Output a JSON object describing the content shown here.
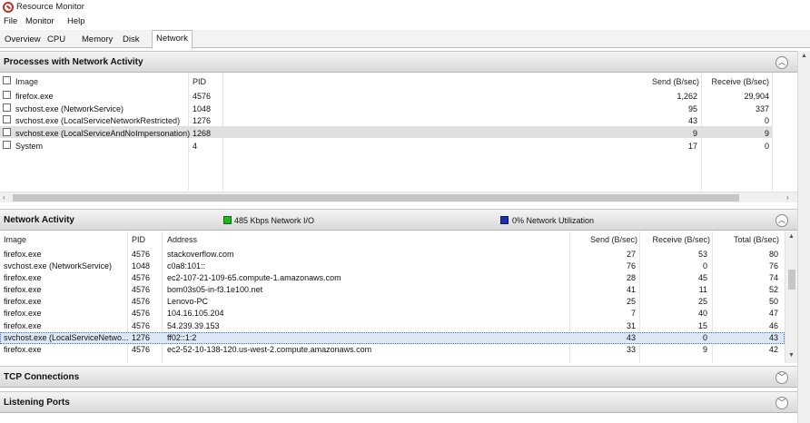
{
  "window": {
    "title": "Resource Monitor"
  },
  "menu": [
    "File",
    "Monitor",
    "Help"
  ],
  "tabs": [
    "Overview",
    "CPU",
    "Memory",
    "Disk",
    "Network"
  ],
  "processes": {
    "title": "Processes with Network Activity",
    "columns": {
      "image": "Image",
      "pid": "PID",
      "send": "Send (B/sec)",
      "receive": "Receive (B/sec)"
    },
    "rows": [
      {
        "image": "firefox.exe",
        "pid": "4576",
        "send": "1,262",
        "receive": "29,904"
      },
      {
        "image": "svchost.exe (NetworkService)",
        "pid": "1048",
        "send": "95",
        "receive": "337"
      },
      {
        "image": "svchost.exe (LocalServiceNetworkRestricted)",
        "pid": "1276",
        "send": "43",
        "receive": "0"
      },
      {
        "image": "svchost.exe (LocalServiceAndNoImpersonation)",
        "pid": "1268",
        "send": "9",
        "receive": "9"
      },
      {
        "image": "System",
        "pid": "4",
        "send": "17",
        "receive": "0"
      }
    ]
  },
  "network_activity": {
    "title": "Network Activity",
    "io_label": "485 Kbps Network I/O",
    "util_label": "0% Network Utilization",
    "io_color": "#1fb51f",
    "util_color": "#1a2fa8",
    "columns": {
      "image": "Image",
      "pid": "PID",
      "address": "Address",
      "send": "Send (B/sec)",
      "receive": "Receive (B/sec)",
      "total": "Total (B/sec)"
    },
    "rows": [
      {
        "image": "firefox.exe",
        "pid": "4576",
        "address": "stackoverflow.com",
        "send": "27",
        "receive": "53",
        "total": "80"
      },
      {
        "image": "svchost.exe (NetworkService)",
        "pid": "1048",
        "address": "c0a8:101::",
        "send": "76",
        "receive": "0",
        "total": "76"
      },
      {
        "image": "firefox.exe",
        "pid": "4576",
        "address": "ec2-107-21-109-65.compute-1.amazonaws.com",
        "send": "28",
        "receive": "45",
        "total": "74"
      },
      {
        "image": "firefox.exe",
        "pid": "4576",
        "address": "bom03s05-in-f3.1e100.net",
        "send": "41",
        "receive": "11",
        "total": "52"
      },
      {
        "image": "firefox.exe",
        "pid": "4576",
        "address": "Lenovo-PC",
        "send": "25",
        "receive": "25",
        "total": "50"
      },
      {
        "image": "firefox.exe",
        "pid": "4576",
        "address": "104.16.105.204",
        "send": "7",
        "receive": "40",
        "total": "47"
      },
      {
        "image": "firefox.exe",
        "pid": "4576",
        "address": "54.239.39.153",
        "send": "31",
        "receive": "15",
        "total": "46"
      },
      {
        "image": "svchost.exe (LocalServiceNetwo...",
        "pid": "1276",
        "address": "ff02::1:2",
        "send": "43",
        "receive": "0",
        "total": "43"
      },
      {
        "image": "firefox.exe",
        "pid": "4576",
        "address": "ec2-52-10-138-120.us-west-2.compute.amazonaws.com",
        "send": "33",
        "receive": "9",
        "total": "42"
      }
    ]
  },
  "tcp": {
    "title": "TCP Connections"
  },
  "listening": {
    "title": "Listening Ports"
  },
  "icons": {
    "collapse": "chevron-up-icon",
    "expand": "chevron-down-icon"
  }
}
